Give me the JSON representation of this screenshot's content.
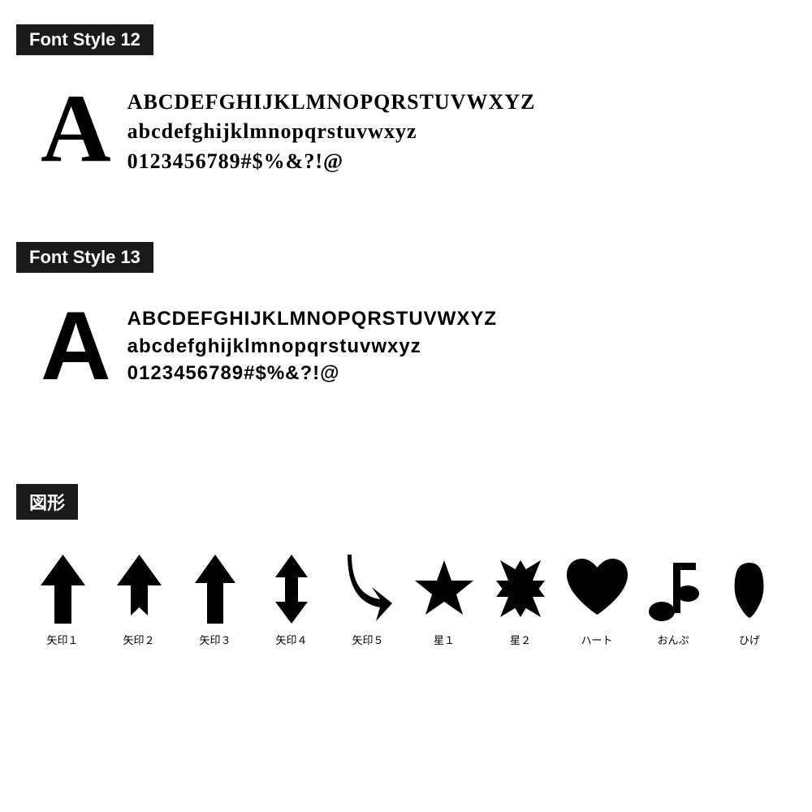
{
  "sections": [
    {
      "id": "font-style-12",
      "header": "Font Style 12",
      "style": "serif",
      "big_letter": "A",
      "lines": [
        "ABCDEFGHIJKLMNOPQRSTUVWXYZ",
        "abcdefghijklmnopqrstuvwxyz",
        "0123456789#$%&?!@"
      ]
    },
    {
      "id": "font-style-13",
      "header": "Font Style 13",
      "style": "sans",
      "big_letter": "A",
      "lines": [
        "ABCDEFGHIJKLMNOPQRSTUVWXYZ",
        "abcdefghijklmnopqrstuvwxyz",
        "0123456789#$%&?!@"
      ]
    }
  ],
  "shapes_section": {
    "header": "図形",
    "items": [
      {
        "id": "yajirushi1",
        "label": "矢印１"
      },
      {
        "id": "yajirushi2",
        "label": "矢印２"
      },
      {
        "id": "yajirushi3",
        "label": "矢印３"
      },
      {
        "id": "yajirushi4",
        "label": "矢印４"
      },
      {
        "id": "yajirushi5",
        "label": "矢印５"
      },
      {
        "id": "hoshi1",
        "label": "星１"
      },
      {
        "id": "hoshi2",
        "label": "星２"
      },
      {
        "id": "heart",
        "label": "ハート"
      },
      {
        "id": "onpu",
        "label": "おんぷ"
      },
      {
        "id": "hige",
        "label": "ひげ"
      }
    ]
  }
}
